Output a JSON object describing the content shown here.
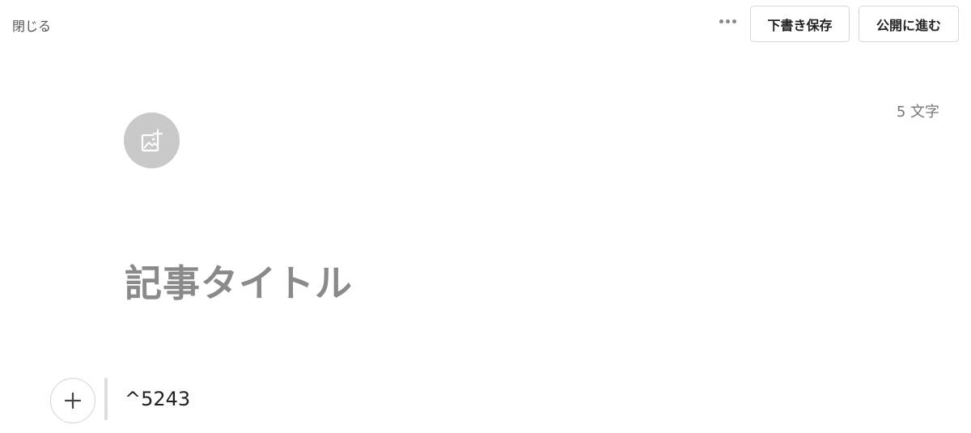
{
  "header": {
    "close_label": "閉じる",
    "more_icon": "more-horizontal-icon",
    "save_draft_label": "下書き保存",
    "publish_label": "公開に進む"
  },
  "editor": {
    "char_count": "5 文字",
    "image_add_icon": "image-plus-icon",
    "title_placeholder": "記事タイトル",
    "add_block_icon": "plus-icon",
    "body_text": "^5243"
  }
}
